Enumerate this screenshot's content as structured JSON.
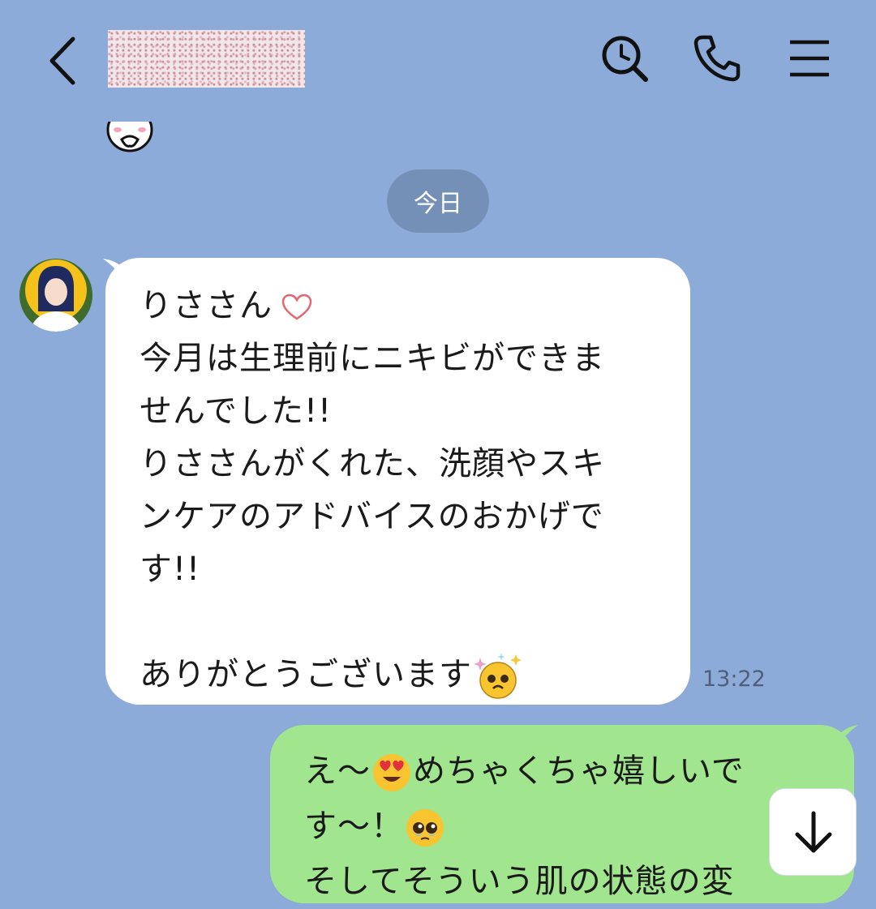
{
  "header": {
    "back_icon": "chevron-left-icon",
    "search_icon": "search-clock-icon",
    "call_icon": "phone-icon",
    "menu_icon": "menu-icon"
  },
  "date_divider": "今日",
  "messages": {
    "received": {
      "lines": [
        "りささん",
        "今月は生理前にニキビができま",
        "せんでした!!",
        "りささんがくれた、洗顔やスキ",
        "ンケアのアドバイスのおかげで",
        "す!!",
        "",
        "ありがとうございます"
      ],
      "time": "13:22"
    },
    "sent": {
      "line1a": "え〜",
      "line1b": "めちゃくちゃ嬉しいで",
      "line2": "す〜！",
      "line3": "そしてそういう肌の状態の変"
    }
  },
  "colors": {
    "background": "#8cabd9",
    "received_bubble": "#ffffff",
    "sent_bubble": "#a1e58e",
    "date_pill": "#7590b6"
  }
}
